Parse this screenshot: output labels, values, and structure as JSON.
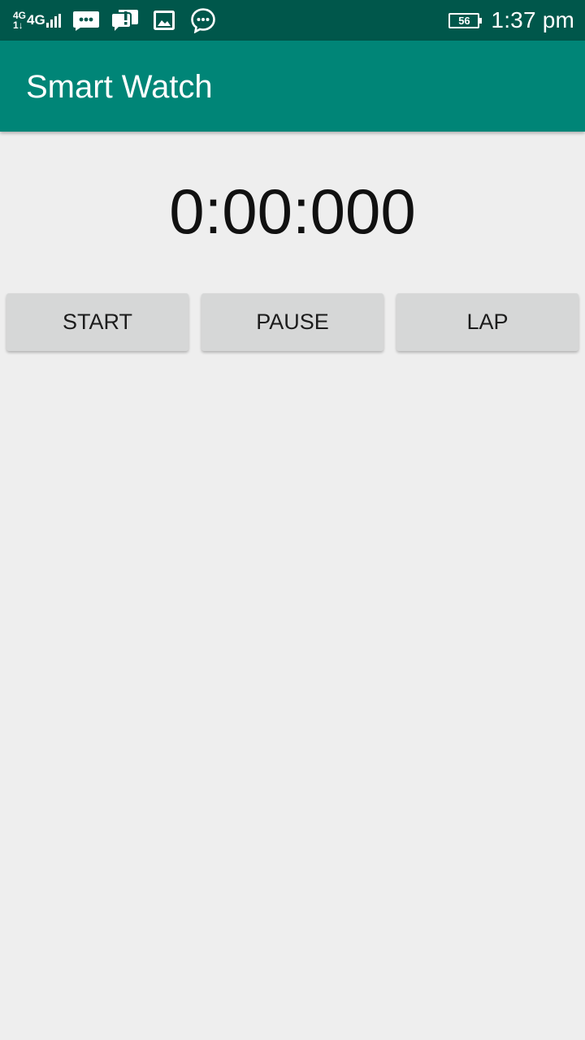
{
  "status_bar": {
    "network_top": "4G",
    "network_bottom": "1↓",
    "network_second": "4G",
    "notification_icons": [
      "message-icon",
      "chat-alert-icon",
      "gallery-icon",
      "chat-dots-icon"
    ],
    "battery_level": "56",
    "time": "1:37 pm"
  },
  "app_bar": {
    "title": "Smart Watch"
  },
  "stopwatch": {
    "display": "0:00:000"
  },
  "controls": {
    "start_label": "START",
    "pause_label": "PAUSE",
    "lap_label": "LAP"
  },
  "colors": {
    "status_bar": "#00574b",
    "app_bar": "#008577",
    "background": "#eeeeee",
    "button": "#d6d7d7"
  }
}
